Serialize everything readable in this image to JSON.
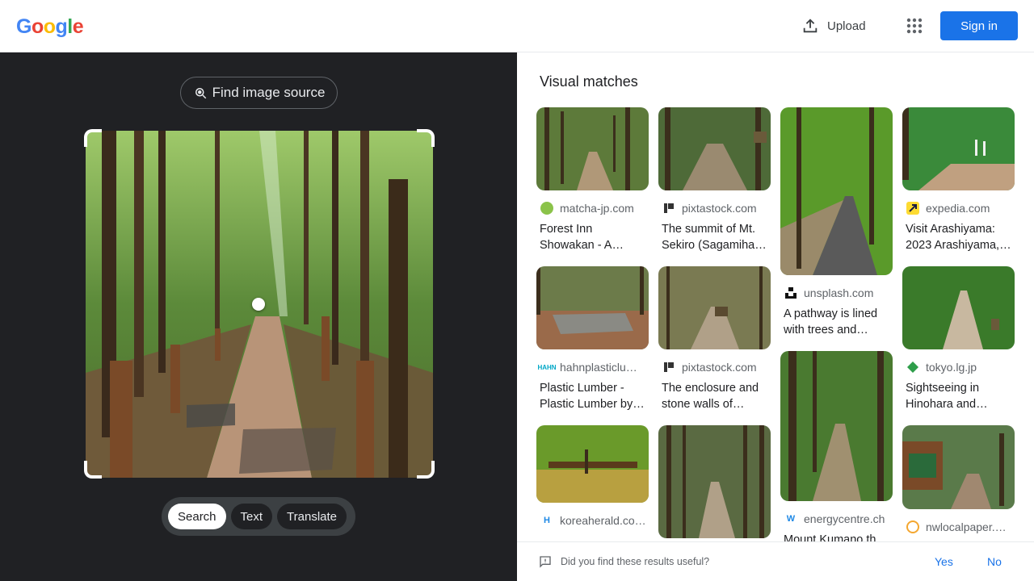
{
  "header": {
    "logo_letters": [
      {
        "ch": "G",
        "color": "#4285f4"
      },
      {
        "ch": "o",
        "color": "#ea4335"
      },
      {
        "ch": "o",
        "color": "#fbbc05"
      },
      {
        "ch": "g",
        "color": "#4285f4"
      },
      {
        "ch": "l",
        "color": "#34a853"
      },
      {
        "ch": "e",
        "color": "#ea4335"
      }
    ],
    "upload_label": "Upload",
    "apps_icon": "apps-grid-icon",
    "signin_label": "Sign in"
  },
  "left": {
    "find_source_label": "Find image source",
    "modes": [
      "Search",
      "Text",
      "Translate"
    ],
    "active_mode": "Search"
  },
  "right": {
    "title": "Visual matches",
    "columns": [
      [
        {
          "source": "matcha-jp.com",
          "title": "Forest Inn Showakan - A…",
          "fav": "green-dot"
        },
        {
          "source": "hahnplasticlu…",
          "title": "Plastic Lumber - Plastic Lumber by…",
          "fav": "hahn"
        },
        {
          "source": "koreaherald.co…",
          "title": "",
          "fav": "kh"
        }
      ],
      [
        {
          "source": "pixtastock.com",
          "title": "The summit of Mt. Sekiro (Sagamiha…",
          "fav": "pixta"
        },
        {
          "source": "pixtastock.com",
          "title": "The enclosure and stone walls of…",
          "fav": "pixta"
        },
        {
          "source": "",
          "title": "",
          "fav": ""
        }
      ],
      [
        {
          "source": "unsplash.com",
          "title": "A pathway is lined with trees and…",
          "fav": "unsplash"
        },
        {
          "source": "energycentre.ch",
          "title": "Mount Kumano th…",
          "fav": "w"
        }
      ],
      [
        {
          "source": "expedia.com",
          "title": "Visit Arashiyama: 2023 Arashiyama,…",
          "fav": "expedia"
        },
        {
          "source": "tokyo.lg.jp",
          "title": "Sightseeing in Hinohara and…",
          "fav": "tokyo"
        },
        {
          "source": "nwlocalpaper.…",
          "title": "",
          "fav": "nw"
        }
      ]
    ]
  },
  "feedback": {
    "question": "Did you find these results useful?",
    "yes": "Yes",
    "no": "No"
  }
}
